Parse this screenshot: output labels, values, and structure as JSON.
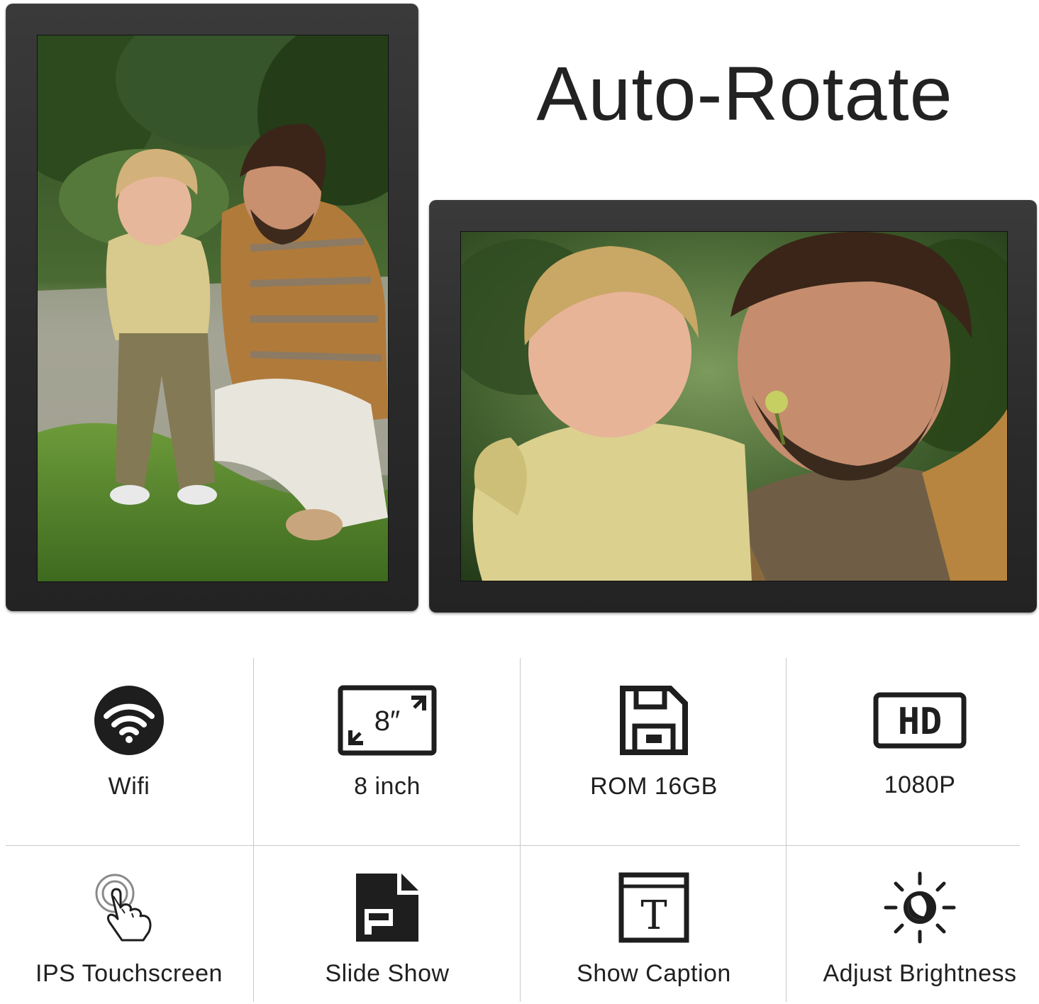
{
  "headline": "Auto-Rotate",
  "frames": [
    {
      "orientation": "portrait",
      "content": "photo-father-child-outdoors"
    },
    {
      "orientation": "landscape",
      "content": "photo-father-child-closeup"
    }
  ],
  "colors": {
    "frame": "#2e2e2e",
    "icon": "#232323",
    "divider": "#c9c9c9",
    "text": "#202020"
  },
  "features": [
    {
      "label": "Wifi",
      "icon": "wifi-icon"
    },
    {
      "label": "8 inch",
      "icon": "screen-size-icon",
      "icon_text": "8″"
    },
    {
      "label": "ROM 16GB",
      "icon": "floppy-disk-icon"
    },
    {
      "label": "1080P",
      "icon": "hd-icon",
      "icon_text": "HD"
    },
    {
      "label": "IPS Touchscreen",
      "icon": "touch-hand-icon"
    },
    {
      "label": "Slide Show",
      "icon": "slide-file-icon"
    },
    {
      "label": "Show Caption",
      "icon": "text-caption-icon",
      "icon_text": "T"
    },
    {
      "label": "Adjust Brightness",
      "icon": "brightness-icon"
    }
  ]
}
